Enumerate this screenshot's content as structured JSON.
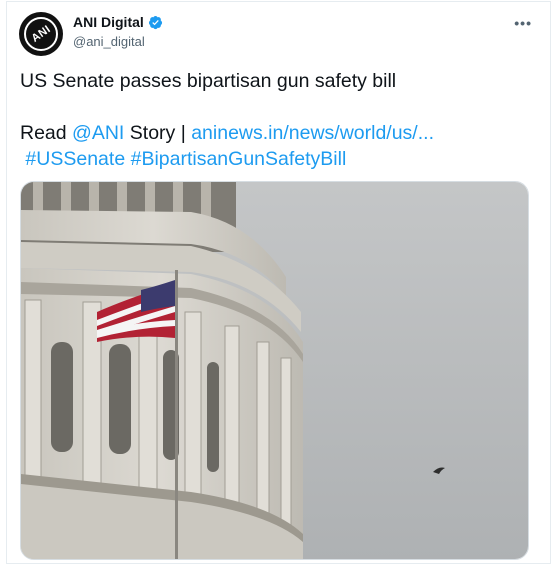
{
  "author": {
    "display_name": "ANI Digital",
    "handle": "@ani_digital",
    "avatar_text": "ANI",
    "verified": true,
    "verified_icon": "verified-badge-icon"
  },
  "menu": {
    "more_label": "•••",
    "icon": "more-options-icon"
  },
  "tweet": {
    "headline": "US Senate passes bipartisan gun safety bill",
    "read_prefix": "Read ",
    "mention": "@ANI",
    "story_text": " Story | ",
    "url": "aninews.in/news/world/us/...",
    "hashtags": [
      "#USSenate",
      "#BipartisanGunSafetyBill"
    ]
  },
  "media": {
    "description_icon": "capitol-dome-photo",
    "colors": {
      "sky": "#b9bcbe",
      "stone": "#d4d2cc",
      "flag_red": "#b22234",
      "flag_blue": "#3c3b6e"
    }
  },
  "colors": {
    "link": "#1d9bf0",
    "text": "#0f1419",
    "muted": "#536471"
  }
}
